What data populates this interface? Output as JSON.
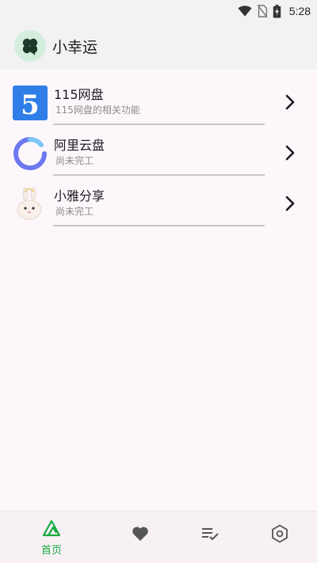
{
  "status_bar": {
    "time": "5:28",
    "icons": [
      "wifi-icon",
      "no-sim-icon",
      "battery-charging-icon"
    ]
  },
  "app_bar": {
    "logo_icon": "clover-icon",
    "title": "小幸运"
  },
  "list": [
    {
      "title": "115网盘",
      "subtitle": "115网盘的相关功能",
      "icon": "115-logo"
    },
    {
      "title": "阿里云盘",
      "subtitle": "尚未完工",
      "icon": "aliyun-drive-logo"
    },
    {
      "title": "小雅分享",
      "subtitle": "尚未完工",
      "icon": "bunny-logo"
    }
  ],
  "nav": {
    "items": [
      {
        "label": "首页",
        "icon": "home-icon",
        "active": true
      },
      {
        "label": "",
        "icon": "heart-icon",
        "active": false
      },
      {
        "label": "",
        "icon": "checklist-icon",
        "active": false
      },
      {
        "label": "",
        "icon": "settings-icon",
        "active": false
      }
    ]
  },
  "colors": {
    "accent": "#1aab3f",
    "background": "#fdf7fc",
    "bar": "#f2f2f2",
    "logo_blue": "#2f7ee8"
  },
  "logo_texts": {
    "115": "5"
  }
}
